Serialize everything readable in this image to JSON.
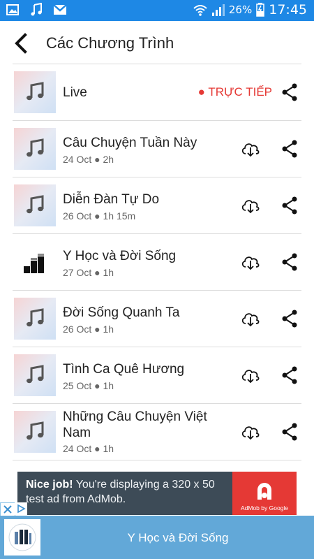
{
  "status_bar": {
    "battery": "26%",
    "time": "17:45",
    "icons": [
      "gallery-icon",
      "music-note-icon",
      "gmail-icon",
      "wifi-icon",
      "signal-icon",
      "battery-icon"
    ]
  },
  "header": {
    "title": "Các Chương Trình",
    "back_icon": "chevron-left-icon"
  },
  "programs": [
    {
      "title": "Live",
      "meta": "",
      "live_label": "● TRỰC TIẾP",
      "thumb": "music-note-icon"
    },
    {
      "title": "Câu Chuyện Tuần Này",
      "meta": "24 Oct ● 2h",
      "thumb": "music-note-icon"
    },
    {
      "title": "Diễn Đàn Tự Do",
      "meta": "26 Oct ● 1h 15m",
      "thumb": "music-note-icon"
    },
    {
      "title": "Y Học và Đời Sống",
      "meta": "27 Oct ● 1h",
      "thumb": "equalizer-bars-icon"
    },
    {
      "title": "Đời Sống Quanh Ta",
      "meta": "26 Oct ● 1h",
      "thumb": "music-note-icon"
    },
    {
      "title": "Tình Ca Quê Hương",
      "meta": "25 Oct ● 1h",
      "thumb": "music-note-icon"
    },
    {
      "title": "Những Câu Chuyện Việt Nam",
      "meta": "24 Oct ● 1h",
      "thumb": "music-note-icon"
    }
  ],
  "ad": {
    "headline": "Nice job!",
    "body": " You're displaying a 320 x 50 test ad from AdMob.",
    "logo_label": "AdMob by Google"
  },
  "player": {
    "title": "Y Học và Đời Sống",
    "art_icon": "equalizer-bars-icon"
  },
  "colors": {
    "status_bar": "#1e88e5",
    "live": "#e53935",
    "player_bg": "#62a8d8",
    "ad_bg": "#3d4b57"
  }
}
